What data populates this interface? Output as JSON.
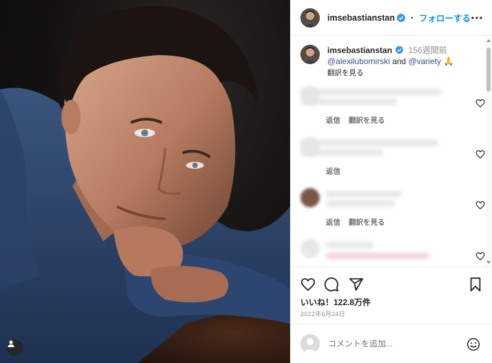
{
  "post": {
    "username": "imsebastianstan",
    "follow_label": "フォローする",
    "dot": "・"
  },
  "caption": {
    "username": "imsebastianstan",
    "time": "156週間前",
    "mention1": "@alexilubomirski",
    "and": " and ",
    "mention2": "@variety",
    "emoji": "🙏",
    "translate": "翻訳を見る"
  },
  "comments": [
    {
      "reply": "返信",
      "translate": "翻訳を見る"
    },
    {
      "reply": "返信",
      "translate": ""
    },
    {
      "reply": "返信",
      "translate": "翻訳を見る"
    },
    {
      "reply": "",
      "translate": ""
    }
  ],
  "likes": "いいね！122.8万件",
  "date": "2022年6月24日",
  "add_comment": {
    "placeholder": "コメントを追加..."
  },
  "colors": {
    "accent": "#0095f6",
    "mention": "#385185",
    "verified": "#3897f0"
  },
  "icons": [
    "verified-badge-icon",
    "more-options-icon",
    "heart-icon",
    "comment-icon",
    "share-icon",
    "bookmark-icon",
    "emoji-icon",
    "user-tag-icon"
  ]
}
